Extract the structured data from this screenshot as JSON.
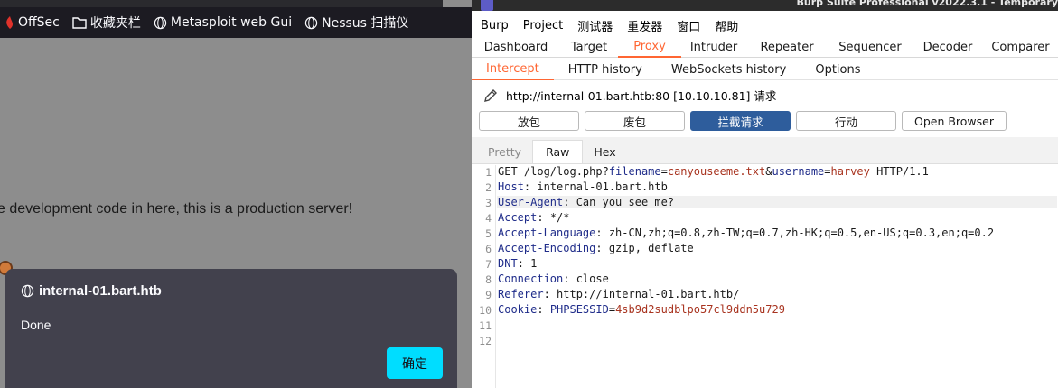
{
  "browser": {
    "bookmarks": [
      {
        "icon": "offsec-icon",
        "label": "OffSec"
      },
      {
        "icon": "folder-icon",
        "label": "收藏夹栏"
      },
      {
        "icon": "globe-icon",
        "label": "Metasploit web Gui"
      },
      {
        "icon": "globe-icon",
        "label": "Nessus 扫描仪"
      }
    ],
    "page_text": "e development code in here, this is a production server!",
    "dialog": {
      "title": "internal-01.bart.htb",
      "message": "Done",
      "ok_label": "确定",
      "ok_color": "#00ddff"
    }
  },
  "burp": {
    "title": "Burp Suite Professional v2022.3.1 - Temporary",
    "menu": [
      "Burp",
      "Project",
      "测试器",
      "重发器",
      "窗口",
      "帮助"
    ],
    "main_tabs": [
      "Dashboard",
      "Target",
      "Proxy",
      "Intruder",
      "Repeater",
      "Sequencer",
      "Decoder",
      "Comparer"
    ],
    "main_tab_active": "Proxy",
    "sub_tabs": [
      "Intercept",
      "HTTP history",
      "WebSockets history",
      "Options"
    ],
    "sub_tab_active": "Intercept",
    "request_target": "http://internal-01.bart.htb:80  [10.10.10.81] 请求",
    "buttons": {
      "forward": "放包",
      "drop": "废包",
      "intercept": "拦截请求",
      "action": "行动",
      "open_browser": "Open Browser"
    },
    "view_tabs": [
      "Pretty",
      "Raw",
      "Hex"
    ],
    "view_tab_active": "Raw",
    "accent_color": "#ff6633",
    "primary_button_color": "#2e5d9c",
    "request_lines": [
      {
        "n": "1",
        "text": "GET /log/log.php?filename=canyouseeme.txt&username=harvey HTTP/1.1"
      },
      {
        "n": "2",
        "key": "Host",
        "value": "internal-01.bart.htb"
      },
      {
        "n": "3",
        "key": "User-Agent",
        "value": "Can you see me?"
      },
      {
        "n": "4",
        "key": "Accept",
        "value": "*/*"
      },
      {
        "n": "5",
        "key": "Accept-Language",
        "value": "zh-CN,zh;q=0.8,zh-TW;q=0.7,zh-HK;q=0.5,en-US;q=0.3,en;q=0.2"
      },
      {
        "n": "6",
        "key": "Accept-Encoding",
        "value": "gzip, deflate"
      },
      {
        "n": "7",
        "key": "DNT",
        "value": "1"
      },
      {
        "n": "8",
        "key": "Connection",
        "value": "close"
      },
      {
        "n": "9",
        "key": "Referer",
        "value": "http://internal-01.bart.htb/"
      },
      {
        "n": "10",
        "key": "Cookie",
        "value": "PHPSESSID=4sb9d2sudblpo57cl9ddn5u729"
      },
      {
        "n": "11",
        "text": ""
      },
      {
        "n": "12",
        "text": ""
      }
    ],
    "request_line_parts": {
      "method_path": "GET /log/log.php?",
      "p1_key": "filename",
      "p1_val": "canyouseeme.txt",
      "amp": "&",
      "p2_key": "username",
      "p2_val": "harvey",
      "proto": " HTTP/1.1",
      "cookie_key": "PHPSESSID",
      "cookie_val": "4sb9d2sudblpo57cl9ddn5u729"
    }
  }
}
